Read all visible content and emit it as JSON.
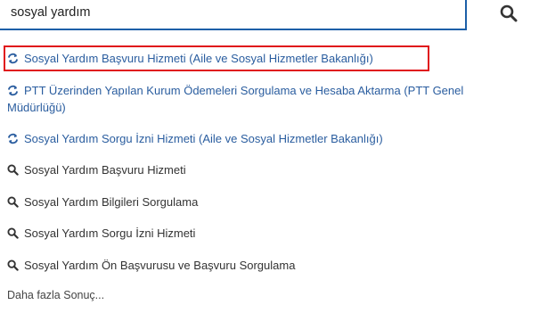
{
  "search": {
    "value": "sosyal yardım",
    "button_icon": "search-icon"
  },
  "results": {
    "service_items": [
      {
        "label": "Sosyal Yardım Başvuru Hizmeti (Aile ve Sosyal Hizmetler Bakanlığı)",
        "icon": "refresh-icon"
      },
      {
        "label": "PTT Üzerinden Yapılan Kurum Ödemeleri Sorgulama ve Hesaba Aktarma (PTT Genel",
        "label2": "Müdürlüğü)",
        "icon": "refresh-icon"
      },
      {
        "label": "Sosyal Yardım Sorgu İzni Hizmeti (Aile ve Sosyal Hizmetler Bakanlığı)",
        "icon": "refresh-icon"
      }
    ],
    "search_items": [
      {
        "label": "Sosyal Yardım Başvuru Hizmeti",
        "icon": "search-icon"
      },
      {
        "label": "Sosyal Yardım Bilgileri Sorgulama",
        "icon": "search-icon"
      },
      {
        "label": "Sosyal Yardım Sorgu İzni Hizmeti",
        "icon": "search-icon"
      },
      {
        "label": "Sosyal Yardım Ön Başvurusu ve Başvuru Sorgulama",
        "icon": "search-icon"
      }
    ],
    "more_label": "Daha fazla Sonuç..."
  },
  "colors": {
    "link": "#2a5d9f",
    "highlight": "#e0151b",
    "border": "#1c5fa8"
  }
}
